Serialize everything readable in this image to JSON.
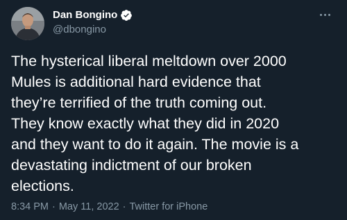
{
  "author": {
    "display_name": "Dan Bongino",
    "handle": "@dbongino",
    "verified": true
  },
  "tweet": {
    "text": "The hysterical liberal meltdown over 2000\nMules is additional hard evidence that\nthey’re terrified of the truth coming out.\nThey know exactly what they did in 2020\nand they want to do it again. The movie is a\ndevastating indictment of our broken\nelections."
  },
  "meta": {
    "time": "8:34 PM",
    "date": "May 11, 2022",
    "separator": "·",
    "source": "Twitter for iPhone"
  },
  "icons": {
    "verified": "verified-badge-icon",
    "more": "more-options-icon"
  },
  "colors": {
    "background": "#15202b",
    "text": "#ffffff",
    "secondary_text": "#8899a6",
    "verified": "#ffffff"
  }
}
